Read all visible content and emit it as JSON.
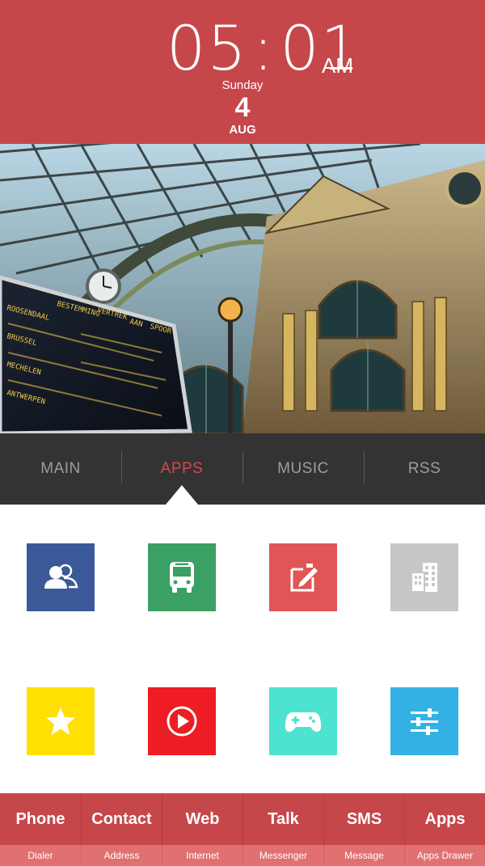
{
  "clock": {
    "hours": "05",
    "separator": ":",
    "minutes": "01",
    "ampm": "AM",
    "weekday": "Sunday",
    "day": "4",
    "month": "AUG"
  },
  "wallpaper": {
    "board_text": [
      "VERTREK",
      "BESTEMMING",
      "AAN",
      "SPOOR",
      "ROOSENDAAL",
      "BRUSSEL",
      "MECHELEN",
      "ANTWERPEN"
    ]
  },
  "tabs": [
    {
      "label": "MAIN",
      "active": false
    },
    {
      "label": "APPS",
      "active": true
    },
    {
      "label": "MUSIC",
      "active": false
    },
    {
      "label": "RSS",
      "active": false
    }
  ],
  "tiles": [
    {
      "icon": "contacts-icon",
      "color": "#3b5998"
    },
    {
      "icon": "bus-icon",
      "color": "#3aa063"
    },
    {
      "icon": "note-edit-icon",
      "color": "#e05555"
    },
    {
      "icon": "buildings-icon",
      "color": "#c7c7c7"
    },
    {
      "icon": "star-icon",
      "color": "#ffe000"
    },
    {
      "icon": "play-icon",
      "color": "#ee1c23"
    },
    {
      "icon": "gamepad-icon",
      "color": "#4de3d0"
    },
    {
      "icon": "sliders-icon",
      "color": "#33b1e5"
    }
  ],
  "dock": [
    {
      "label": "Phone",
      "sub": "Dialer"
    },
    {
      "label": "Contact",
      "sub": "Address"
    },
    {
      "label": "Web",
      "sub": "Internet"
    },
    {
      "label": "Talk",
      "sub": "Messenger"
    },
    {
      "label": "SMS",
      "sub": "Message"
    },
    {
      "label": "Apps",
      "sub": "Apps Drawer"
    }
  ],
  "colors": {
    "accent": "#c6474a",
    "accent_light": "#e17070",
    "tab_bar": "#333333",
    "tab_active": "#d3494d"
  }
}
